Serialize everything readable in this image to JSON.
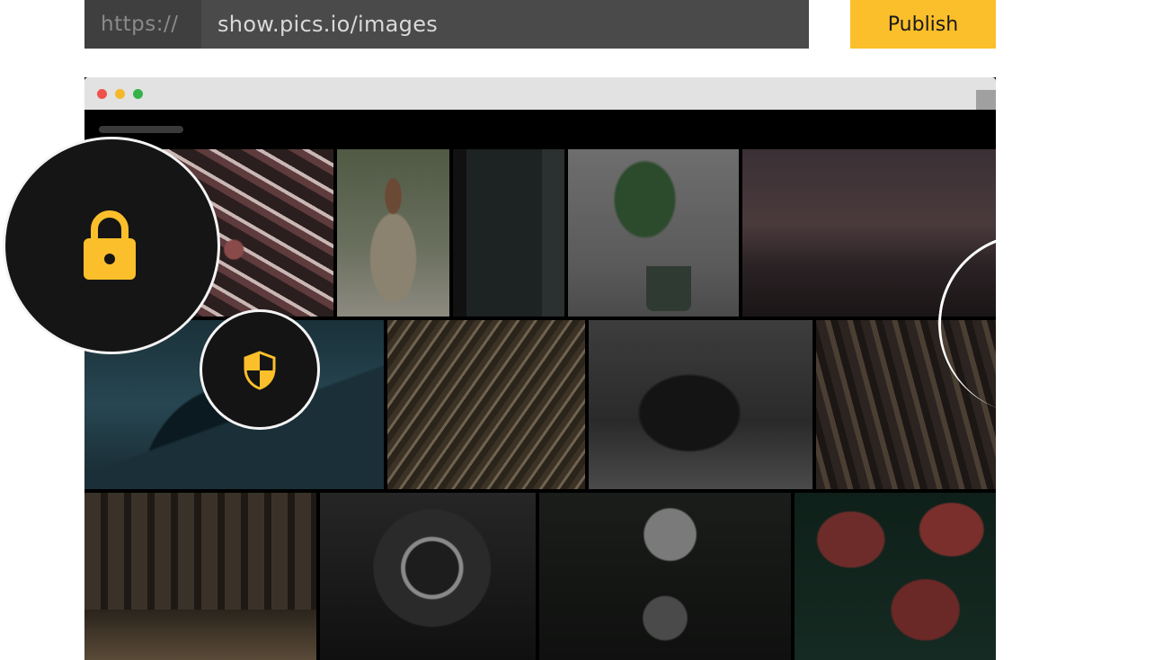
{
  "url_bar": {
    "protocol": "https://",
    "path": "show.pics.io/images"
  },
  "publish_button": {
    "label": "Publish"
  },
  "window": {
    "controls": [
      "close",
      "minimize",
      "maximize"
    ]
  },
  "badges": {
    "lock": "lock-icon",
    "shield": "shield-icon"
  },
  "colors": {
    "accent": "#fbbf2b",
    "url_bar_bg": "#4a4a4a",
    "gallery_bg": "#000000"
  },
  "gallery": {
    "images": [
      "scrabble-keys-photo",
      "woman-with-flowers-photo",
      "dark-doorway-photo",
      "plant-in-pot-photo",
      "sunset-rocks-photo",
      "mountain-peak-photo",
      "palm-leaves-photo",
      "typewriter-photo",
      "rock-texture-photo",
      "building-street-photo",
      "car-gauge-photo",
      "crowned-crane-photo",
      "red-tulips-photo"
    ]
  }
}
